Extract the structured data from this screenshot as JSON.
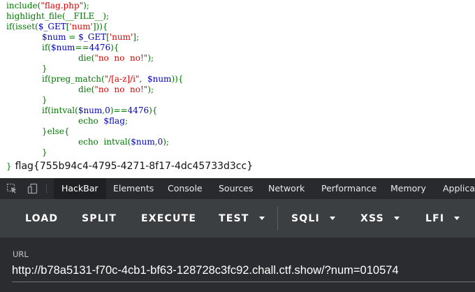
{
  "source_code": {
    "line1": {
      "kw1": "include(",
      "str1": "\"flag.php\"",
      "kw2": ");"
    },
    "line2": {
      "kw1": "highlight_file(__FILE__);"
    },
    "line3": {
      "kw1": "if(isset(",
      "var1": "$_GET",
      "kw2": "[",
      "str1": "'num'",
      "kw3": "])){"
    },
    "line4": {
      "var1": "$num",
      "kw1": " = ",
      "var2": "$_GET",
      "kw2": "[",
      "str1": "'num'",
      "kw3": "];"
    },
    "line5": {
      "kw1": "if(",
      "var1": "$num",
      "kw2": "==",
      "var2": "4476",
      "kw3": "){"
    },
    "line6": {
      "kw1": "die(",
      "str1": "\"no  no  no!\"",
      "kw2": ");"
    },
    "line7": {
      "kw1": "}"
    },
    "line8": {
      "kw1": "if(preg_match(",
      "str1": "\"/[a-z]/i\"",
      "kw2": ",  ",
      "var1": "$num",
      "kw3": ")){"
    },
    "line9": {
      "kw1": "die(",
      "str1": "\"no  no  no!\"",
      "kw2": ");"
    },
    "line10": {
      "kw1": "}"
    },
    "line11": {
      "kw1": "if(intval(",
      "var1": "$num",
      "kw2": ",",
      "var2": "0",
      "kw3": ")==",
      "var3": "4476",
      "kw4": "){"
    },
    "line12": {
      "kw1": "echo  ",
      "var1": "$flag",
      "kw2": ";"
    },
    "line13": {
      "kw1": "}else{"
    },
    "line14": {
      "kw1": "echo  intval(",
      "var1": "$num",
      "kw2": ",",
      "var2": "0",
      "kw3": ");"
    },
    "line15": {
      "kw1": "}"
    },
    "line16": {
      "kw1": "}"
    }
  },
  "output": {
    "flag": "flag{755b94c4-4795-4271-8f17-4dc45733d3cc}"
  },
  "devtools": {
    "icons": [
      "inspect-element-icon",
      "device-toolbar-icon"
    ],
    "tabs": {
      "hackbar": "HackBar",
      "elements": "Elements",
      "console": "Console",
      "sources": "Sources",
      "network": "Network",
      "performance": "Performance",
      "memory": "Memory",
      "application": "Application"
    },
    "active_tab": "HackBar"
  },
  "hackbar": {
    "buttons": {
      "load": "LOAD",
      "split": "SPLIT",
      "execute": "EXECUTE",
      "test": "TEST",
      "sqli": "SQLI",
      "xss": "XSS",
      "lfi": "LFI"
    },
    "url_label": "URL",
    "url_value": "http://b78a5131-f70c-4cb1-bf63-128728c3fc92.chall.ctf.show/?num=010574"
  },
  "colors": {
    "php_keyword": "#007700",
    "php_string": "#dd0000",
    "php_variable": "#0000bb",
    "devtools_bg": "#292a2d",
    "hackbar_toolbar_bg": "#3c3f42",
    "url_panel_bg": "#2a2c2f"
  }
}
